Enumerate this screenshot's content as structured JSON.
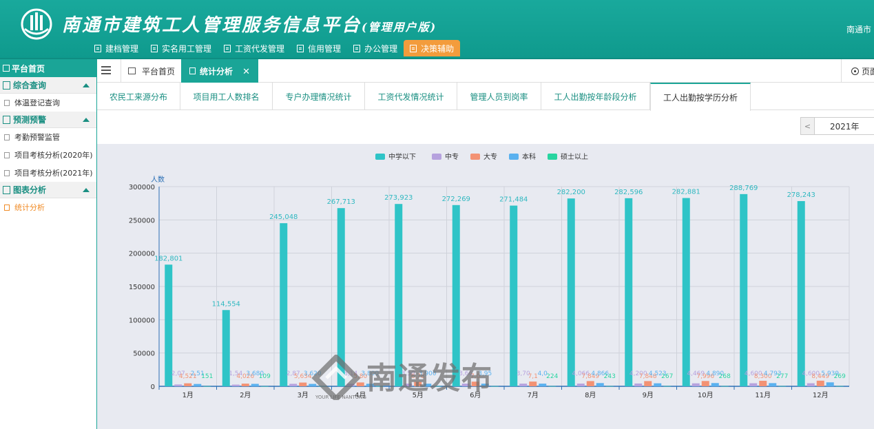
{
  "header": {
    "title": "南通市建筑工人管理服务信息平台",
    "title_suffix": "(管理用户版)",
    "right_text": "南通市"
  },
  "topnav": [
    {
      "label": "建档管理",
      "active": false
    },
    {
      "label": "实名用工管理",
      "active": false
    },
    {
      "label": "工资代发管理",
      "active": false
    },
    {
      "label": "信用管理",
      "active": false
    },
    {
      "label": "办公管理",
      "active": false
    },
    {
      "label": "决策辅助",
      "active": true
    }
  ],
  "sidebar": {
    "home": "平台首页",
    "groups": [
      {
        "label": "综合查询",
        "items": [
          {
            "label": "体温登记查询",
            "active": false
          }
        ]
      },
      {
        "label": "预测预警",
        "items": [
          {
            "label": "考勤预警监管",
            "active": false
          },
          {
            "label": "项目考核分析(2020年)",
            "active": false
          },
          {
            "label": "项目考核分析(2021年)",
            "active": false
          }
        ]
      },
      {
        "label": "图表分析",
        "items": [
          {
            "label": "统计分析",
            "active": true
          }
        ]
      }
    ]
  },
  "tabs": {
    "home": "平台首页",
    "active": "统计分析",
    "right": "页面"
  },
  "subtabs": [
    "农民工来源分布",
    "项目用工人数排名",
    "专户办理情况统计",
    "工资代发情况统计",
    "管理人员到岗率",
    "工人出勤按年龄段分析",
    "工人出勤按学历分析"
  ],
  "year_selector": {
    "value": "2021年"
  },
  "watermark": {
    "text": "南通发布",
    "sub": "YOUR LIFE NANTONG"
  },
  "chart_data": {
    "type": "bar",
    "ylabel": "人数",
    "ylim": [
      0,
      300000
    ],
    "yticks": [
      0,
      50000,
      100000,
      150000,
      200000,
      250000,
      300000
    ],
    "categories": [
      "1月",
      "2月",
      "3月",
      "4月",
      "5月",
      "6月",
      "7月",
      "8月",
      "9月",
      "10月",
      "11月",
      "12月"
    ],
    "legend_position": "top-center",
    "series": [
      {
        "name": "中学以下",
        "color": "#2fc4c7",
        "values": [
          182801,
          114554,
          245048,
          267713,
          273923,
          272269,
          271484,
          282200,
          282596,
          282881,
          288769,
          278243
        ],
        "labels": [
          "182,801",
          "114,554",
          "245,048",
          "267,713",
          "273,923",
          "272,269",
          "271,484",
          "282,200",
          "282,596",
          "282,881",
          "288,769",
          "278,243"
        ]
      },
      {
        "name": "中专",
        "color": "#b6a2de",
        "values": [
          2700,
          2500,
          3700,
          3900,
          4000,
          4000,
          4000,
          4066,
          4200,
          4469,
          4600,
          4600
        ],
        "labels": [
          "2,07",
          "1,54",
          "2,87",
          "3,14",
          "3,50",
          "3,66",
          "3,70",
          "4,066",
          "4,200",
          "4,469",
          "4,600",
          "4,600"
        ]
      },
      {
        "name": "大专",
        "color": "#f39274",
        "values": [
          4521,
          4026,
          5634,
          5800,
          6780,
          7000,
          7100,
          7849,
          7848,
          7996,
          8300,
          8449
        ],
        "labels": [
          "4,521",
          "4,026",
          "5,634",
          "5,80",
          "6,78",
          "7,0",
          "7,1",
          "7,849",
          "7,848",
          "7,996",
          "8,300",
          "8,449"
        ]
      },
      {
        "name": "本科",
        "color": "#5ab1ef",
        "values": [
          3500,
          3680,
          3620,
          3800,
          3900,
          3950,
          4000,
          4866,
          4523,
          4890,
          4793,
          5939
        ],
        "labels": [
          "2,51",
          "3,680",
          "3,620",
          "3,800",
          "3,900",
          "3,95",
          "4,0",
          "4,866",
          "4,523",
          "4,890",
          "4,793",
          "5,939"
        ]
      },
      {
        "name": "硕士以上",
        "color": "#28d5a0",
        "values": [
          151,
          109,
          180,
          200,
          210,
          220,
          224,
          243,
          267,
          268,
          277,
          269
        ],
        "labels": [
          "151",
          "109",
          "",
          "",
          "",
          "",
          "224",
          "243",
          "267",
          "268",
          "277",
          "269"
        ]
      }
    ]
  }
}
